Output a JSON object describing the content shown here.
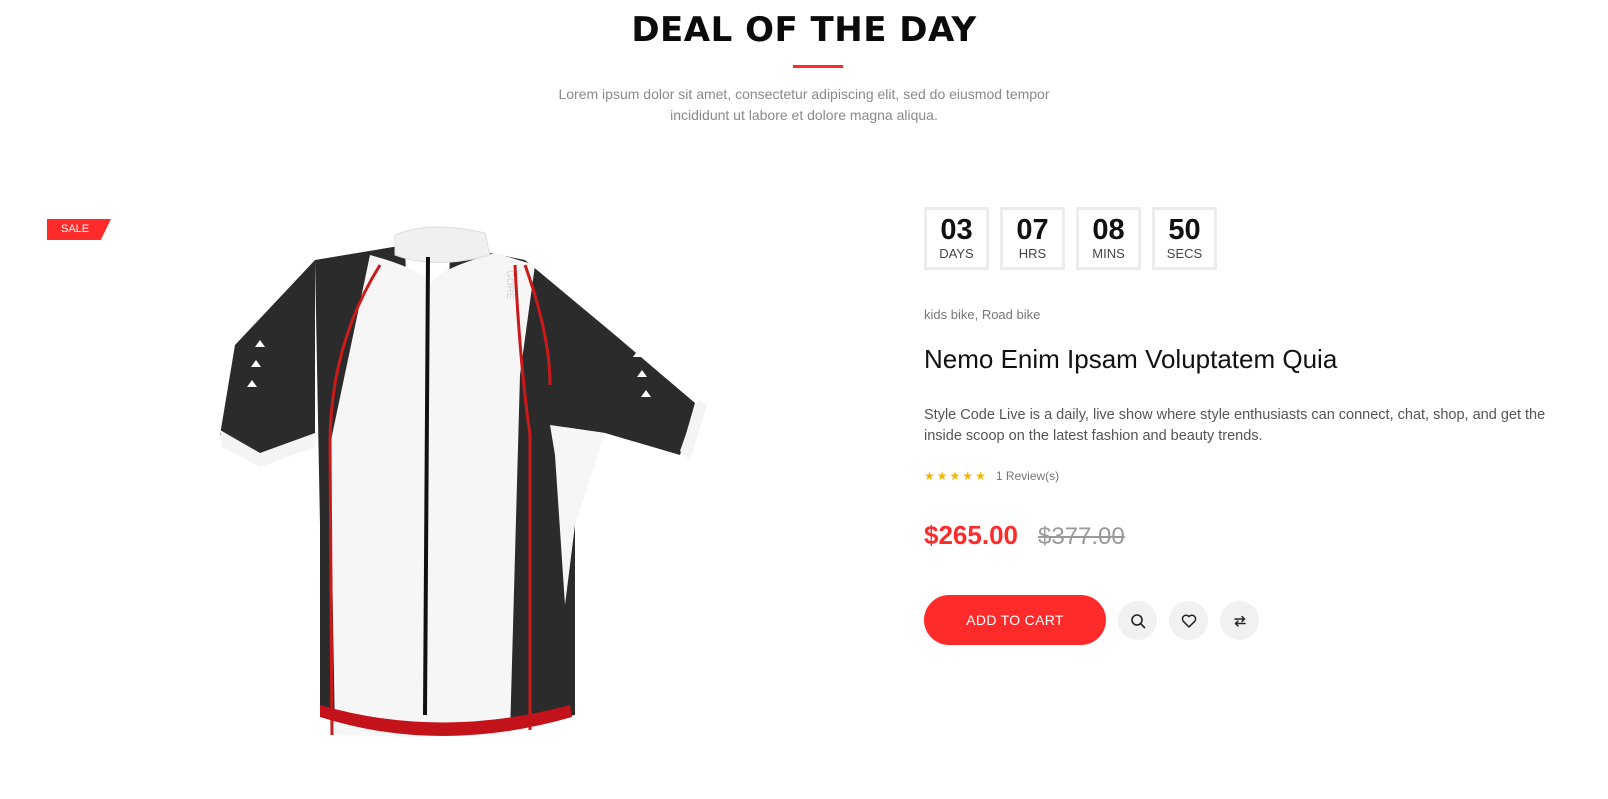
{
  "section": {
    "title": "DEAL OF THE DAY",
    "subtitle": "Lorem ipsum dolor sit amet, consectetur adipiscing elit, sed do eiusmod tempor incididunt ut labore et dolore magna aliqua."
  },
  "badge": {
    "label": "SALE"
  },
  "countdown": [
    {
      "value": "03",
      "label": "DAYS"
    },
    {
      "value": "07",
      "label": "HRS"
    },
    {
      "value": "08",
      "label": "MINS"
    },
    {
      "value": "50",
      "label": "SECS"
    }
  ],
  "product": {
    "categories": [
      "kids bike",
      "Road bike"
    ],
    "title": "Nemo Enim Ipsam Voluptatem Quia",
    "description": "Style Code Live is a daily, live show where style enthusiasts can connect, chat, shop, and get the inside scoop on the latest fashion and beauty trends.",
    "rating": 5,
    "reviews": "1 Review(s)",
    "price": "$265.00",
    "old_price": "$377.00",
    "jersey_brand": "GORE"
  },
  "actions": {
    "add_to_cart": "ADD TO CART",
    "icons": [
      "search-icon",
      "heart-icon",
      "compare-icon"
    ]
  },
  "colors": {
    "accent": "#ff2b2b",
    "jersey_dark": "#2b2b2b",
    "jersey_red": "#cc1a1a"
  }
}
